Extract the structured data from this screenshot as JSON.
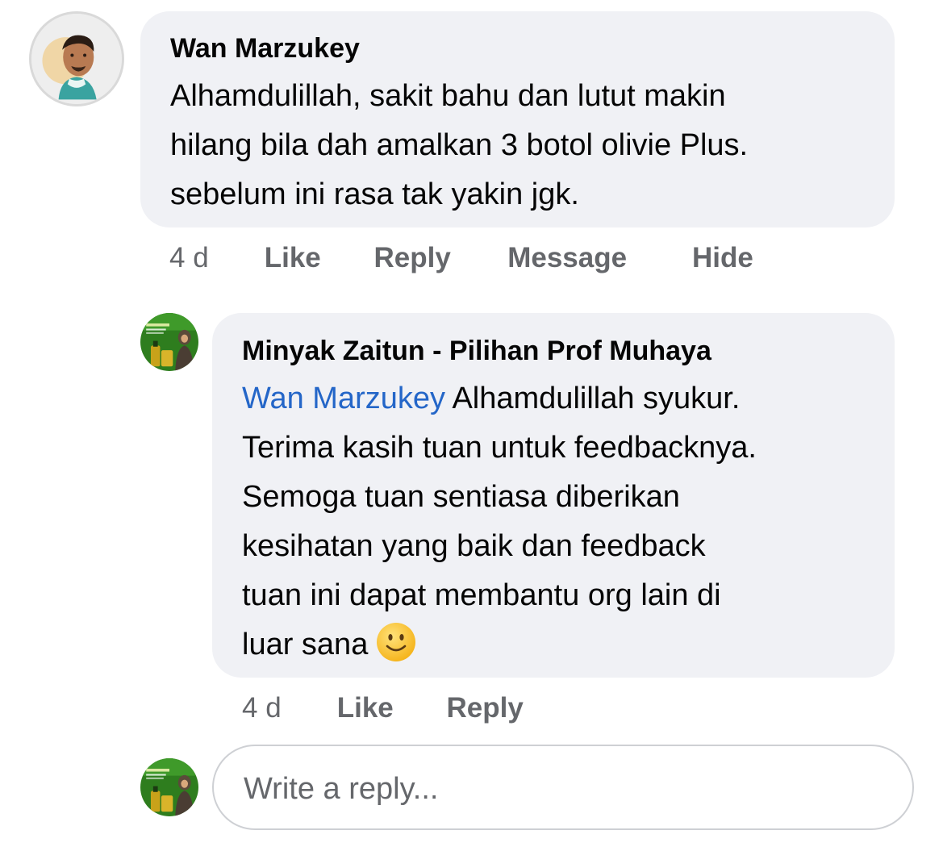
{
  "comment": {
    "author": "Wan Marzukey",
    "lines": [
      "Alhamdulillah, sakit bahu dan lutut makin",
      "hilang bila dah amalkan 3 botol olivie Plus.",
      "sebelum ini rasa tak yakin jgk."
    ],
    "time": "4 d",
    "actions": {
      "like": "Like",
      "reply": "Reply",
      "message": "Message",
      "hide": "Hide"
    },
    "avatar_icon": "man-portrait-avatar"
  },
  "reply": {
    "author": "Minyak Zaitun - Pilihan Prof Muhaya",
    "mention": "Wan Marzukey",
    "lines": [
      " Alhamdulillah syukur.",
      "Terima kasih tuan untuk feedbacknya.",
      "Semoga tuan sentiasa diberikan",
      "kesihatan yang baik dan feedback",
      "tuan ini dapat membantu org lain di",
      "luar sana"
    ],
    "emoji": "slightly-smiling-face",
    "time": "4 d",
    "actions": {
      "like": "Like",
      "reply": "Reply"
    },
    "avatar_icon": "olive-oil-brand-avatar"
  },
  "composer": {
    "placeholder": "Write a reply...",
    "avatar_icon": "olive-oil-brand-avatar"
  },
  "colors": {
    "bubble": "#f0f1f5",
    "mention": "#2466c8",
    "meta": "#65676b",
    "brand_green": "#2e7d1e"
  }
}
